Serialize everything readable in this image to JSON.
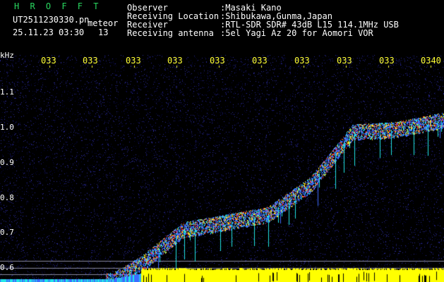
{
  "header": {
    "program": "H R O F F T",
    "filename": "UT2511230330.pn",
    "type_label": "meteor",
    "datetime": "25.11.23 03:30",
    "count": "13",
    "observer_label": "Observer",
    "observer_value": ":Masaki Kano",
    "location_label": "Receiving Location",
    "location_value": ":Shibukawa,Gunma,Japan",
    "receiver_label": "Receiver",
    "receiver_value": ":RTL-SDR SDR# 43dB L15 114.1MHz USB",
    "antenna_label": "Receiving antenna",
    "antenna_value": ":5el Yagi Az 20 for Aomori VOR"
  },
  "time_axis": {
    "tick_labels": [
      "033",
      "033",
      "033",
      "033",
      "033",
      "033",
      "033",
      "033",
      "033",
      "0340"
    ]
  },
  "freq_axis": {
    "unit": "kHz",
    "tick_labels": [
      "1.1",
      "1.0",
      "0.9",
      "0.8",
      "0.7",
      "0.6"
    ]
  },
  "colors": {
    "background": "#000000",
    "noise_dark": "#0a0a44",
    "noise_light": "#2a2a9a",
    "trace_blue": "#3d6bff",
    "trace_cyan": "#22e6e6",
    "trace_red": "#ff3030",
    "trace_yellow": "#ffe020",
    "bottom_band": "#ffff00",
    "tick_yellow": "#ffff33",
    "header_green": "#29d860"
  }
}
